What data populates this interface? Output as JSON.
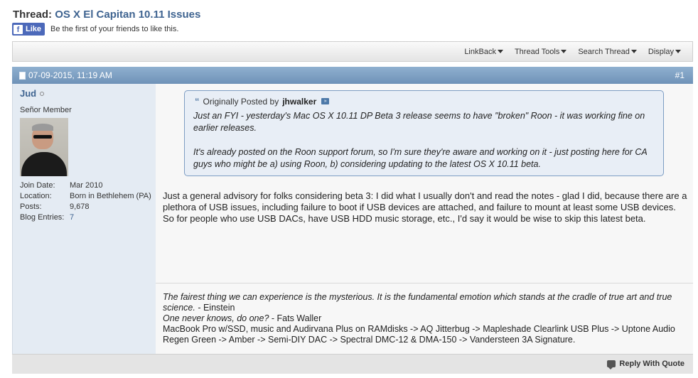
{
  "thread": {
    "prefix": "Thread:",
    "title": "OS X El Capitan 10.11 Issues"
  },
  "facebook": {
    "like_label": "Like",
    "social_text": "Be the first of your friends to like this."
  },
  "toolbar": {
    "items": [
      "LinkBack",
      "Thread Tools",
      "Search Thread",
      "Display"
    ]
  },
  "post": {
    "date": "07-09-2015, 11:19 AM",
    "number": "#1",
    "user": {
      "name": "Jud",
      "title": "Señor Member",
      "stats": [
        {
          "label": "Join Date:",
          "value": "Mar 2010"
        },
        {
          "label": "Location:",
          "value": "Born in Bethlehem (PA)"
        },
        {
          "label": "Posts:",
          "value": "9,678"
        },
        {
          "label": "Blog Entries:",
          "value": "7"
        }
      ]
    },
    "quote": {
      "prefix": "Originally Posted by",
      "author": "jhwalker",
      "paragraph1": "Just an FYI - yesterday's Mac OS X 10.11 DP Beta 3 release seems to have \"broken\" Roon - it was working fine on earlier releases.",
      "paragraph2": "It's already posted on the Roon support forum, so I'm sure they're aware and working on it - just posting here for CA guys who might be a) using Roon, b) considering updating to the latest OS X 10.11 beta."
    },
    "message": "Just a general advisory for folks considering beta 3: I did what I usually don't and read the notes - glad I did, because there are a plethora of USB issues, including failure to boot if USB devices are attached, and failure to mount at least some USB devices. So for people who use USB DACs, have USB HDD music storage, etc., I'd say it would be wise to skip this latest beta.",
    "signature": {
      "quote1": "The fairest thing we can experience is the mysterious. It is the fundamental emotion which stands at the cradle of true art and true science.",
      "quote1_author": " - Einstein",
      "quote2": "One never knows, do one?",
      "quote2_author": " - Fats Waller",
      "system": "MacBook Pro w/SSD, music and Audirvana Plus on RAMdisks -> AQ Jitterbug -> Mapleshade Clearlink USB Plus -> Uptone Audio Regen Green -> Amber -> Semi-DIY DAC -> Spectral DMC-12 & DMA-150 -> Vandersteen 3A Signature."
    },
    "reply_label": "Reply With Quote"
  },
  "colors": {
    "link": "#3e6390",
    "header_bar": "#7f9fc4",
    "user_panel": "#e4ebf3",
    "quote_bg": "#e8eef6"
  }
}
